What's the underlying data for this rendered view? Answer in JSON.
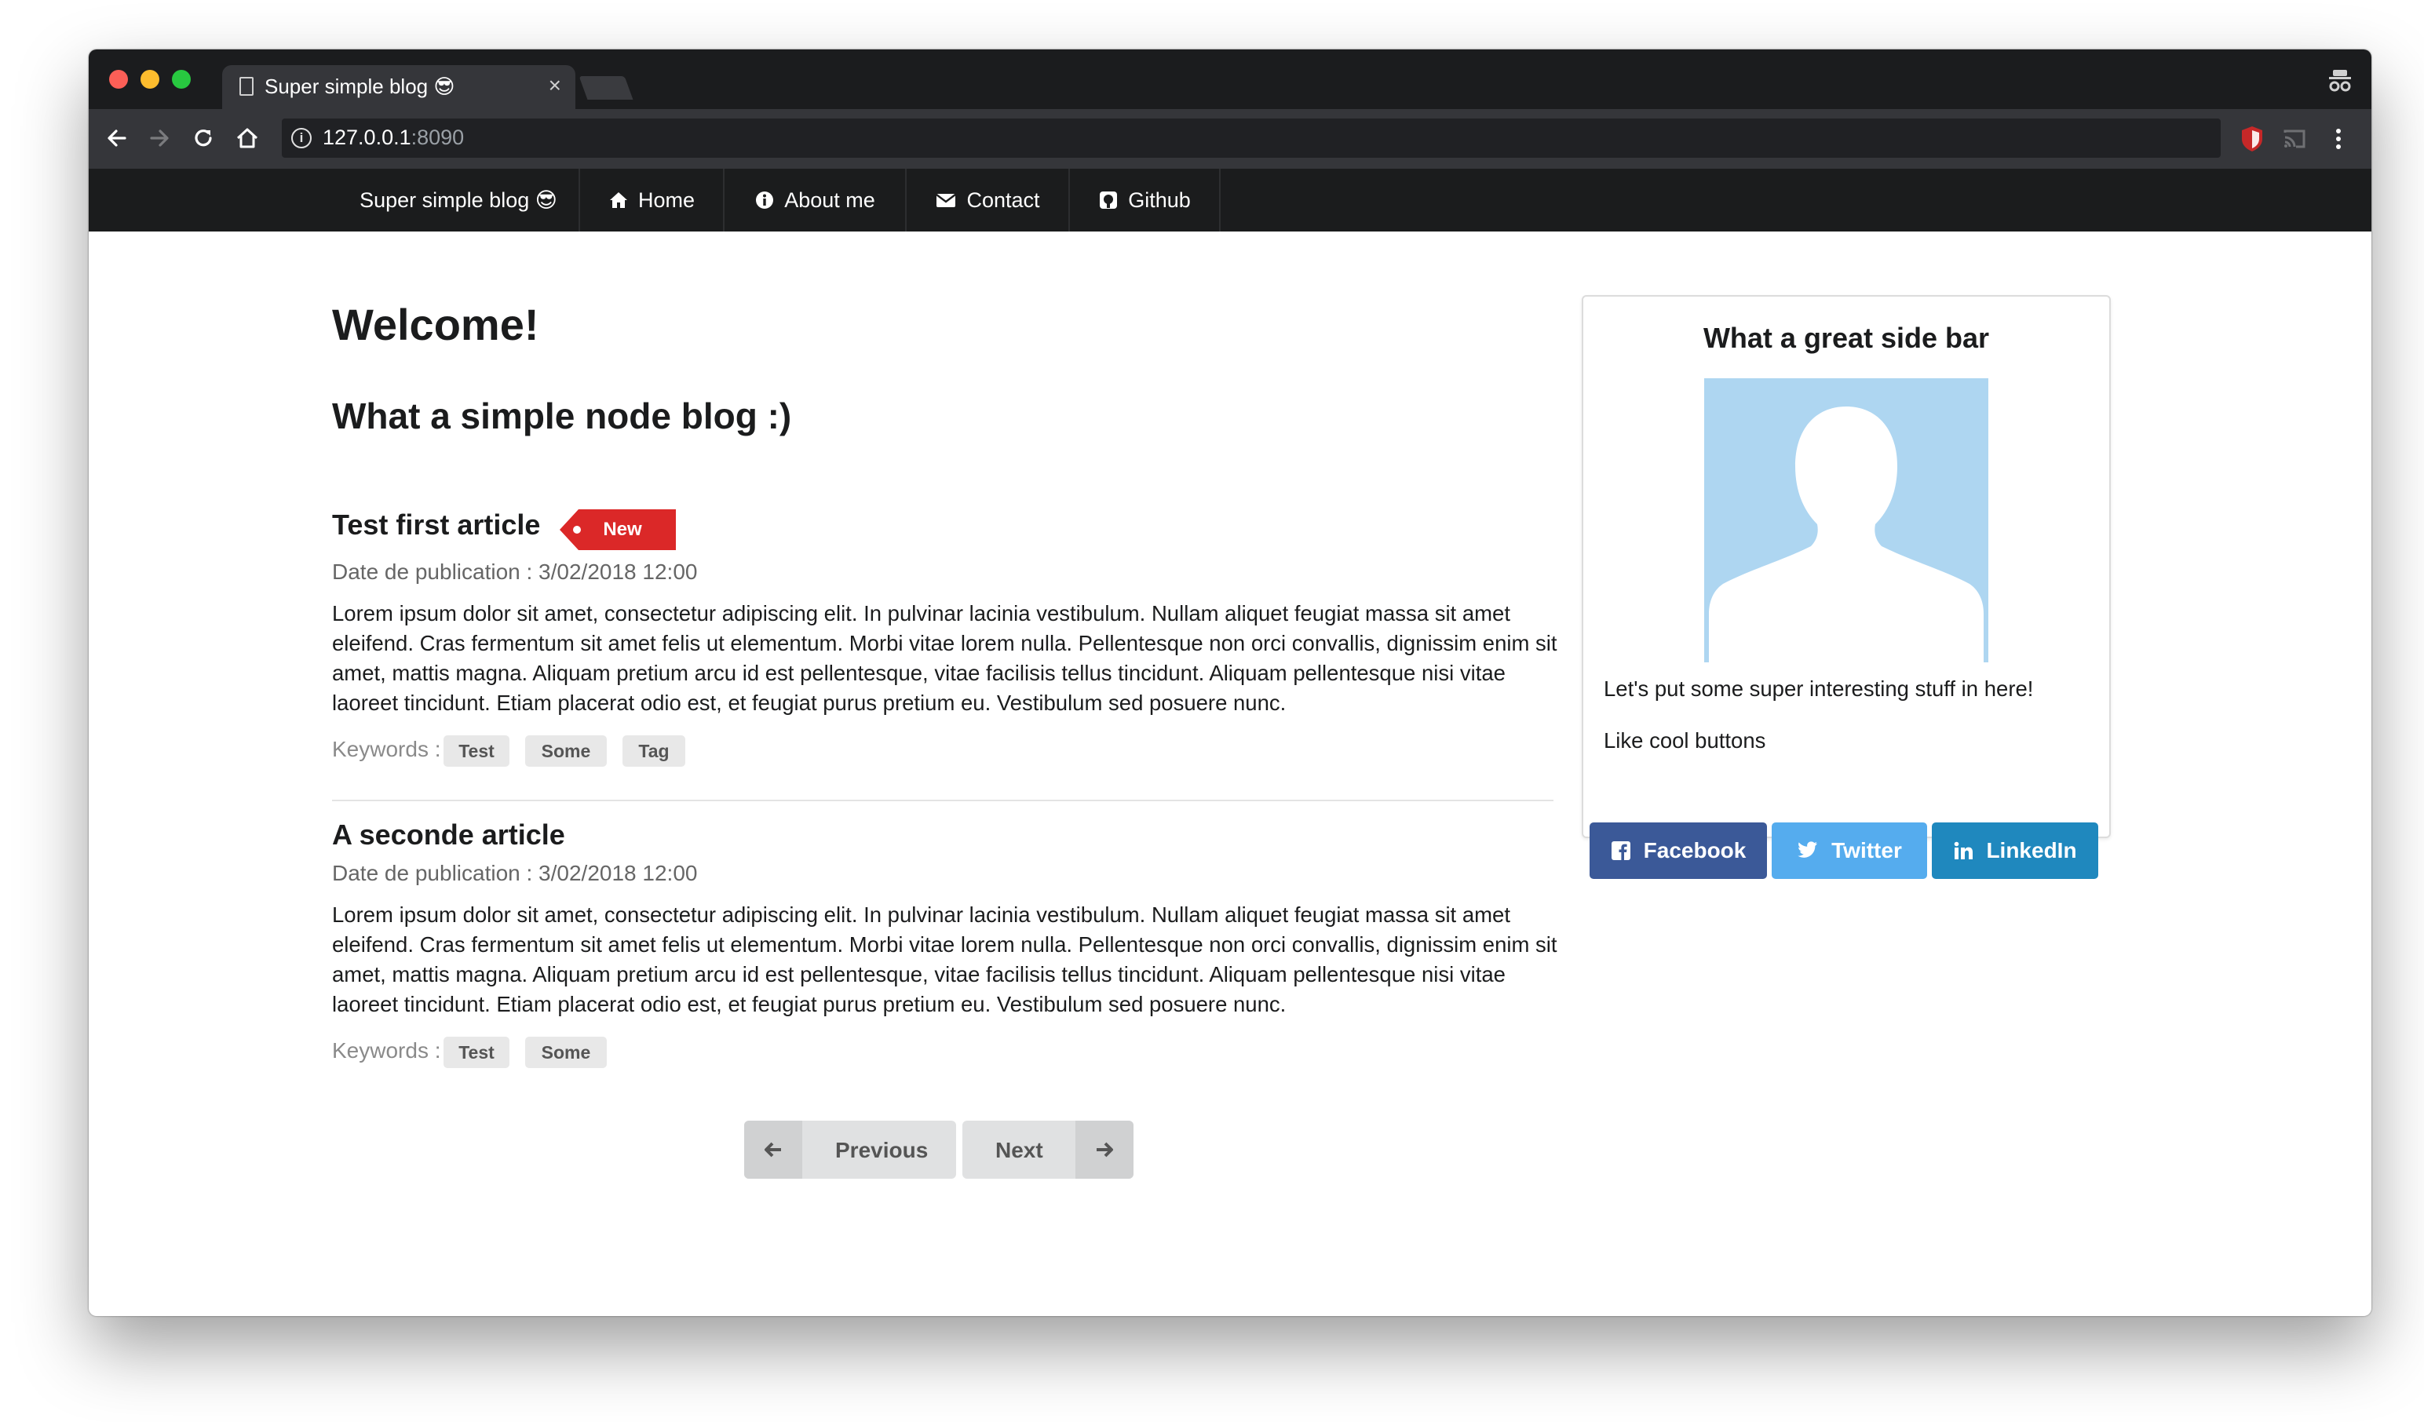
{
  "browser": {
    "tab_title": "Super simple blog 😎",
    "tab_close": "×",
    "url_host": "127.0.0.1",
    "url_port": ":8090",
    "info_glyph": "i"
  },
  "navbar": {
    "brand": "Super simple blog 😎",
    "items": [
      {
        "label": "Home",
        "icon": "home-icon"
      },
      {
        "label": "About me",
        "icon": "info-circle-icon"
      },
      {
        "label": "Contact",
        "icon": "envelope-icon"
      },
      {
        "label": "Github",
        "icon": "github-icon"
      }
    ]
  },
  "main": {
    "heading": "Welcome!",
    "subheading": "What a simple node blog :)",
    "articles": [
      {
        "title": "Test first article",
        "badge": "New",
        "date": "Date de publication : 3/02/2018 12:00",
        "body": "Lorem ipsum dolor sit amet, consectetur adipiscing elit. In pulvinar lacinia vestibulum. Nullam aliquet feugiat massa sit amet eleifend. Cras fermentum sit amet felis ut elementum. Morbi vitae lorem nulla. Pellentesque non orci convallis, dignissim enim sit amet, mattis magna. Aliquam pretium arcu id est pellentesque, vitae facilisis tellus tincidunt. Aliquam pellentesque nisi vitae laoreet tincidunt. Etiam placerat odio est, et feugiat purus pretium eu. Vestibulum sed posuere nunc.",
        "keywords_label": "Keywords :",
        "tags": [
          "Test",
          "Some",
          "Tag"
        ]
      },
      {
        "title": "A seconde article",
        "date": "Date de publication : 3/02/2018 12:00",
        "body": "Lorem ipsum dolor sit amet, consectetur adipiscing elit. In pulvinar lacinia vestibulum. Nullam aliquet feugiat massa sit amet eleifend. Cras fermentum sit amet felis ut elementum. Morbi vitae lorem nulla. Pellentesque non orci convallis, dignissim enim sit amet, mattis magna. Aliquam pretium arcu id est pellentesque, vitae facilisis tellus tincidunt. Aliquam pellentesque nisi vitae laoreet tincidunt. Etiam placerat odio est, et feugiat purus pretium eu. Vestibulum sed posuere nunc.",
        "keywords_label": "Keywords :",
        "tags": [
          "Test",
          "Some"
        ]
      }
    ],
    "pagination": {
      "previous": "Previous",
      "next": "Next"
    }
  },
  "sidebar": {
    "title": "What a great side bar",
    "text1": "Let's put some super interesting stuff in here!",
    "text2": "Like cool buttons",
    "buttons": [
      {
        "label": "Facebook",
        "icon": "facebook-icon",
        "color": "#3b5998"
      },
      {
        "label": "Twitter",
        "icon": "twitter-icon",
        "color": "#55acee"
      },
      {
        "label": "LinkedIn",
        "icon": "linkedin-icon",
        "color": "#1f88be"
      }
    ]
  },
  "colors": {
    "navbar": "#1b1c1d",
    "badge": "#db2828",
    "avatar": "#aed6f1"
  }
}
